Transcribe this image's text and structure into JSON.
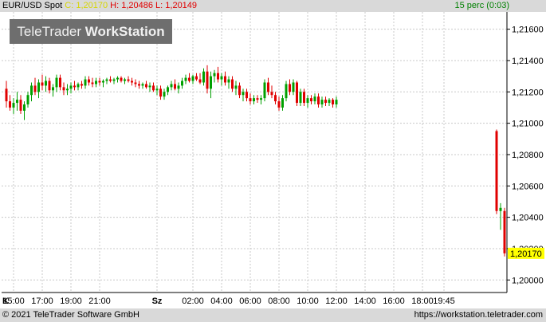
{
  "header": {
    "symbol": "EUR/USD Spot",
    "close_label": "C: 1,20170",
    "high_label": "H: 1,20486",
    "low_label": "L: 1,20149",
    "interval": "15 perc (0:03)",
    "colors": {
      "symbol": "#000000",
      "close": "#d6d600",
      "high": "#e00000",
      "low": "#e00000",
      "interval": "#008000"
    }
  },
  "watermark": {
    "brand": "TeleTrader",
    "product": "WorkStation"
  },
  "footer": {
    "copyright": "© 2021  TeleTrader Software GmbH",
    "url": "https://workstation.teletrader.com"
  },
  "chart_data": {
    "type": "candlestick",
    "y_ticks": [
      "1,21600",
      "1,21400",
      "1,21200",
      "1,21000",
      "1,20800",
      "1,20600",
      "1,20400",
      "1,20200",
      "1,20000"
    ],
    "y_values": [
      1.216,
      1.214,
      1.212,
      1.21,
      1.208,
      1.206,
      1.204,
      1.202,
      1.2
    ],
    "ylim": [
      1.1992,
      1.2171
    ],
    "x_labels": [
      "K",
      "15:00",
      "17:00",
      "19:00",
      "21:00",
      "Sz",
      "02:00",
      "04:00",
      "06:00",
      "08:00",
      "10:00",
      "12:00",
      "14:00",
      "16:00",
      "18:00",
      "19:45"
    ],
    "x_label_bold": [
      true,
      false,
      false,
      false,
      false,
      true,
      false,
      false,
      false,
      false,
      false,
      false,
      false,
      false,
      false,
      false
    ],
    "x_label_index": [
      0,
      2,
      10,
      18,
      26,
      42,
      52,
      60,
      68,
      76,
      84,
      92,
      100,
      108,
      116,
      122
    ],
    "grid": true,
    "last_price_label": "1,20170",
    "last_price": 1.2017,
    "colors": {
      "up": "#00a000",
      "down": "#e00000",
      "grid": "#c8c8c8",
      "last_price_bg": "#ffff00"
    },
    "ohlc": [
      [
        1.2122,
        1.2127,
        1.211,
        1.2114
      ],
      [
        1.2114,
        1.2118,
        1.2108,
        1.211
      ],
      [
        1.211,
        1.2116,
        1.2106,
        1.2113
      ],
      [
        1.2113,
        1.212,
        1.2108,
        1.2115
      ],
      [
        1.2115,
        1.2118,
        1.2106,
        1.2108
      ],
      [
        1.2108,
        1.2114,
        1.2102,
        1.2112
      ],
      [
        1.2112,
        1.212,
        1.211,
        1.2118
      ],
      [
        1.2118,
        1.2126,
        1.2114,
        1.2124
      ],
      [
        1.2124,
        1.2129,
        1.2118,
        1.212
      ],
      [
        1.212,
        1.2128,
        1.2116,
        1.2126
      ],
      [
        1.2126,
        1.2131,
        1.2121,
        1.2124
      ],
      [
        1.2124,
        1.213,
        1.212,
        1.2127
      ],
      [
        1.2127,
        1.2129,
        1.2119,
        1.2121
      ],
      [
        1.2121,
        1.2125,
        1.2117,
        1.2123
      ],
      [
        1.2123,
        1.2131,
        1.212,
        1.2129
      ],
      [
        1.2129,
        1.2131,
        1.2121,
        1.2123
      ],
      [
        1.2123,
        1.2126,
        1.2118,
        1.2121
      ],
      [
        1.2121,
        1.2125,
        1.2118,
        1.2122
      ],
      [
        1.2122,
        1.2126,
        1.2119,
        1.2124
      ],
      [
        1.2124,
        1.2127,
        1.2121,
        1.2123
      ],
      [
        1.2123,
        1.2126,
        1.2121,
        1.2125
      ],
      [
        1.2125,
        1.2127,
        1.2122,
        1.2124
      ],
      [
        1.2124,
        1.213,
        1.2122,
        1.2128
      ],
      [
        1.2128,
        1.213,
        1.2124,
        1.2126
      ],
      [
        1.2126,
        1.2129,
        1.2123,
        1.2125
      ],
      [
        1.2125,
        1.2129,
        1.2123,
        1.2127
      ],
      [
        1.2127,
        1.2129,
        1.2124,
        1.2126
      ],
      [
        1.2126,
        1.2128,
        1.2123,
        1.2127
      ],
      [
        1.2127,
        1.2129,
        1.2125,
        1.2128
      ],
      [
        1.2128,
        1.213,
        1.2126,
        1.2127
      ],
      [
        1.2127,
        1.2129,
        1.2125,
        1.2128
      ],
      [
        1.2128,
        1.213,
        1.2126,
        1.2129
      ],
      [
        1.2129,
        1.213,
        1.2126,
        1.2127
      ],
      [
        1.2127,
        1.2129,
        1.2125,
        1.2128
      ],
      [
        1.2128,
        1.213,
        1.2126,
        1.2127
      ],
      [
        1.2127,
        1.2129,
        1.2124,
        1.2126
      ],
      [
        1.2126,
        1.2128,
        1.2123,
        1.2125
      ],
      [
        1.2125,
        1.2127,
        1.2122,
        1.2124
      ],
      [
        1.2124,
        1.2126,
        1.2122,
        1.2125
      ],
      [
        1.2125,
        1.2127,
        1.2122,
        1.2123
      ],
      [
        1.2123,
        1.2126,
        1.212,
        1.2124
      ],
      [
        1.2124,
        1.2126,
        1.212,
        1.2121
      ],
      [
        1.2121,
        1.2124,
        1.2118,
        1.2122
      ],
      [
        1.2122,
        1.2124,
        1.2115,
        1.2117
      ],
      [
        1.2117,
        1.2122,
        1.2115,
        1.212
      ],
      [
        1.212,
        1.2124,
        1.2118,
        1.2123
      ],
      [
        1.2123,
        1.2127,
        1.2121,
        1.2125
      ],
      [
        1.2125,
        1.2128,
        1.2121,
        1.2122
      ],
      [
        1.2122,
        1.2126,
        1.2119,
        1.2124
      ],
      [
        1.2124,
        1.2129,
        1.2122,
        1.2127
      ],
      [
        1.2127,
        1.2131,
        1.2125,
        1.2129
      ],
      [
        1.2129,
        1.2132,
        1.2126,
        1.2127
      ],
      [
        1.2127,
        1.2131,
        1.2125,
        1.213
      ],
      [
        1.213,
        1.2132,
        1.2127,
        1.2128
      ],
      [
        1.2128,
        1.2132,
        1.2125,
        1.2126
      ],
      [
        1.2126,
        1.2135,
        1.2124,
        1.2133
      ],
      [
        1.2133,
        1.2137,
        1.2119,
        1.2122
      ],
      [
        1.2122,
        1.2133,
        1.2116,
        1.213
      ],
      [
        1.213,
        1.2134,
        1.2126,
        1.2132
      ],
      [
        1.2132,
        1.2136,
        1.2126,
        1.2128
      ],
      [
        1.2128,
        1.2132,
        1.2124,
        1.213
      ],
      [
        1.213,
        1.2133,
        1.2124,
        1.2126
      ],
      [
        1.2126,
        1.213,
        1.2122,
        1.2128
      ],
      [
        1.2128,
        1.213,
        1.212,
        1.2122
      ],
      [
        1.2122,
        1.2127,
        1.2118,
        1.2124
      ],
      [
        1.2124,
        1.2126,
        1.2116,
        1.2118
      ],
      [
        1.2118,
        1.2122,
        1.2114,
        1.212
      ],
      [
        1.212,
        1.2122,
        1.2114,
        1.2116
      ],
      [
        1.2116,
        1.2119,
        1.2112,
        1.2114
      ],
      [
        1.2114,
        1.2118,
        1.2112,
        1.2116
      ],
      [
        1.2116,
        1.2118,
        1.2113,
        1.2115
      ],
      [
        1.2115,
        1.2118,
        1.2112,
        1.2116
      ],
      [
        1.2116,
        1.2128,
        1.2114,
        1.2126
      ],
      [
        1.2126,
        1.2129,
        1.2118,
        1.212
      ],
      [
        1.212,
        1.2124,
        1.2116,
        1.2118
      ],
      [
        1.2118,
        1.212,
        1.2112,
        1.2114
      ],
      [
        1.2114,
        1.2117,
        1.2108,
        1.211
      ],
      [
        1.211,
        1.2118,
        1.2108,
        1.2116
      ],
      [
        1.2116,
        1.2127,
        1.2114,
        1.2125
      ],
      [
        1.2125,
        1.2128,
        1.2118,
        1.212
      ],
      [
        1.212,
        1.2128,
        1.2118,
        1.2126
      ],
      [
        1.2126,
        1.2127,
        1.2111,
        1.2113
      ],
      [
        1.2113,
        1.2122,
        1.2111,
        1.212
      ],
      [
        1.212,
        1.2122,
        1.2111,
        1.2113
      ],
      [
        1.2113,
        1.2118,
        1.211,
        1.2116
      ],
      [
        1.2116,
        1.2118,
        1.2112,
        1.2114
      ],
      [
        1.2114,
        1.2119,
        1.2112,
        1.2117
      ],
      [
        1.2117,
        1.2119,
        1.211,
        1.2112
      ],
      [
        1.2112,
        1.2117,
        1.211,
        1.2115
      ],
      [
        1.2115,
        1.2117,
        1.2111,
        1.2113
      ],
      [
        1.2113,
        1.2116,
        1.2111,
        1.2115
      ],
      [
        1.2115,
        1.2116,
        1.211,
        1.2112
      ],
      [
        1.2112,
        1.2117,
        1.211,
        1.2115
      ]
    ],
    "drop_candles": [
      [
        1.2095,
        1.2096,
        1.2042,
        1.2044
      ],
      [
        1.2044,
        1.2049,
        1.2032,
        1.2046
      ],
      [
        1.2044,
        1.2046,
        1.2015,
        1.2017
      ]
    ]
  }
}
